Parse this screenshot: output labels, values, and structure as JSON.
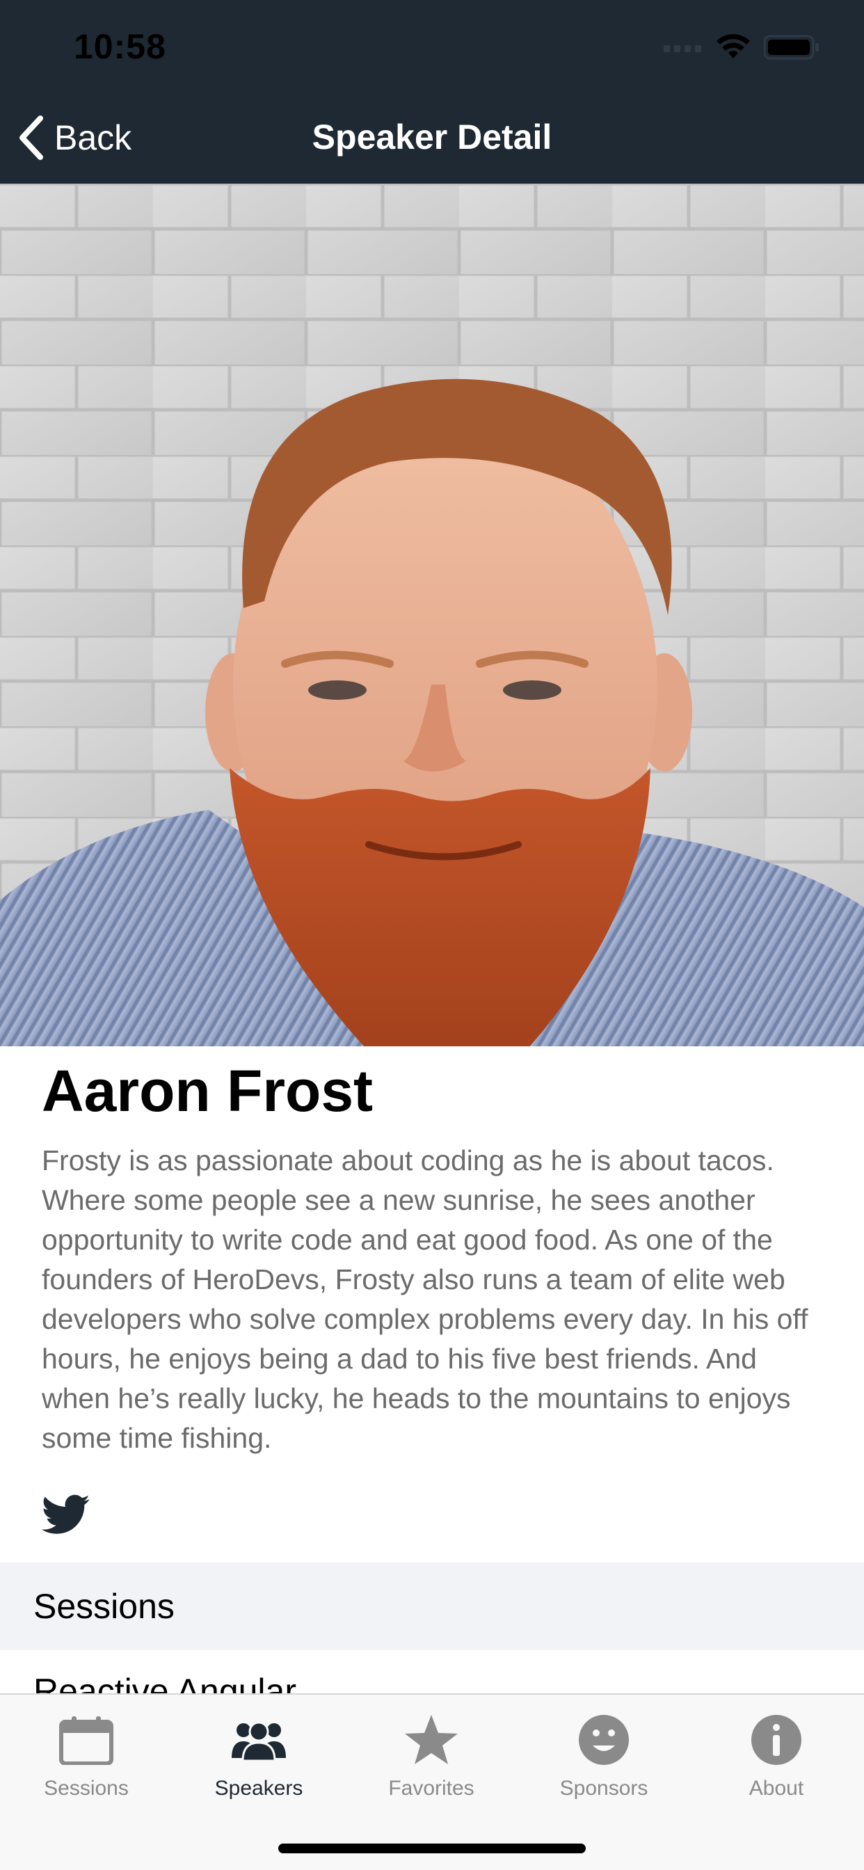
{
  "status_bar": {
    "time": "10:58"
  },
  "nav": {
    "back_label": "Back",
    "title": "Speaker Detail"
  },
  "speaker": {
    "name": "Aaron Frost",
    "bio": "Frosty is as passionate about coding as he is about tacos. Where some people see a new sunrise, he sees another opportunity to write code and eat good food. As one of the founders of HeroDevs, Frosty also runs a team of elite web developers who solve complex problems every day. In his off hours, he enjoys being a dad to his five best friends. And when he’s really lucky, he heads to the mountains to enjoys some time fishing.",
    "social_icon": "twitter-icon"
  },
  "sessions": {
    "header": "Sessions",
    "items": [
      {
        "title": "Reactive Angular"
      }
    ]
  },
  "tabs": [
    {
      "label": "Sessions",
      "icon": "calendar-icon",
      "active": false
    },
    {
      "label": "Speakers",
      "icon": "people-icon",
      "active": true
    },
    {
      "label": "Favorites",
      "icon": "star-icon",
      "active": false
    },
    {
      "label": "Sponsors",
      "icon": "smiley-icon",
      "active": false
    },
    {
      "label": "About",
      "icon": "info-icon",
      "active": false
    }
  ],
  "colors": {
    "nav_background": "#1e2933",
    "tab_active": "#1e2933",
    "tab_inactive": "#8a8a8a",
    "section_header_bg": "#f2f3f7"
  }
}
